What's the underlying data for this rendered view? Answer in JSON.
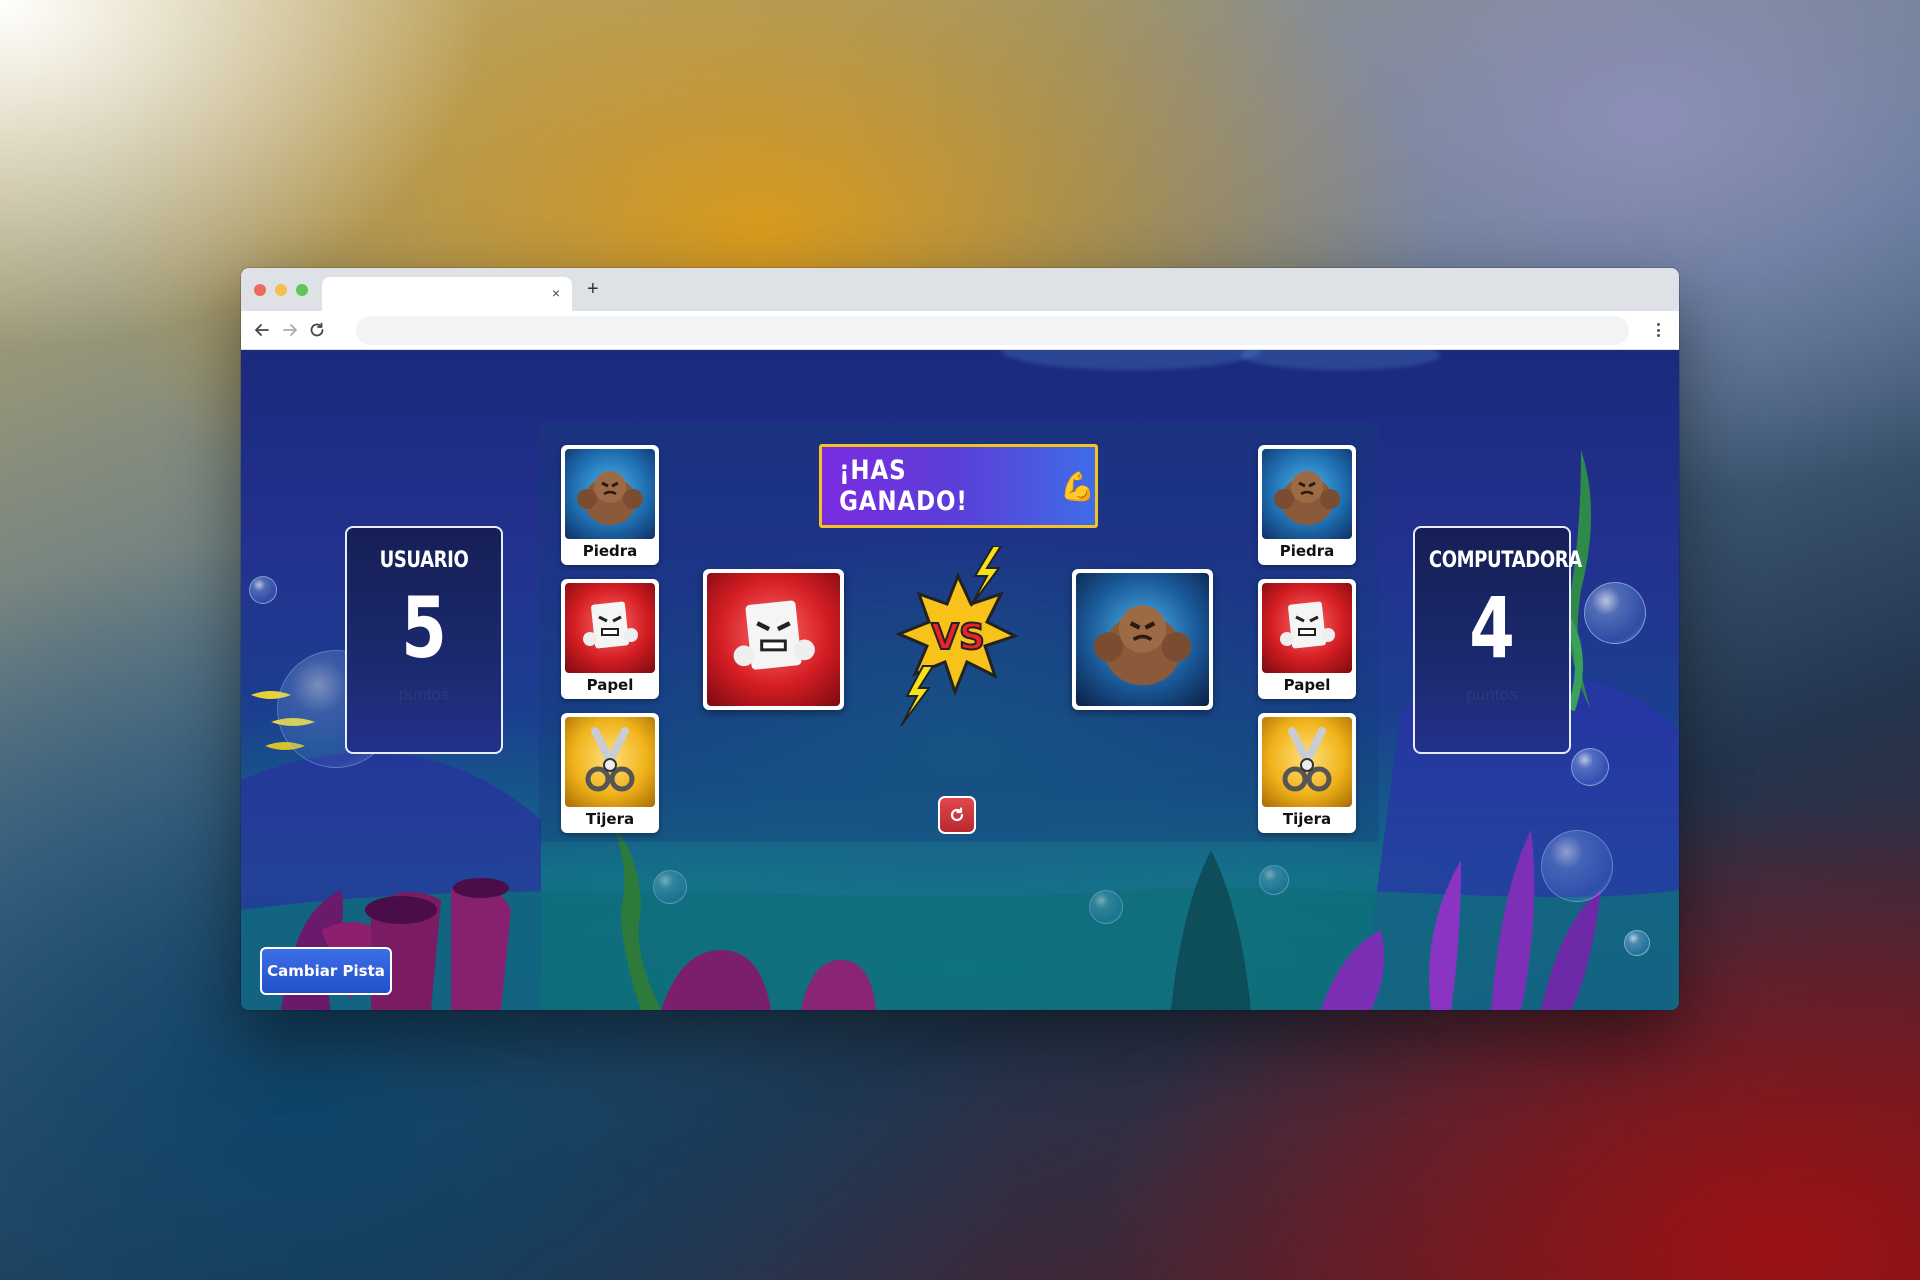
{
  "browser": {
    "tab_title": "",
    "tab_close": "×",
    "new_tab": "+",
    "address": ""
  },
  "game": {
    "user_card": {
      "title": "USUARIO",
      "score": "5",
      "unit": "puntos"
    },
    "computer_card": {
      "title": "COMPUTADORA",
      "score": "4",
      "unit": "puntos"
    },
    "result_banner": "¡HAS GANADO!",
    "result_emoji": "💪",
    "user_choices": [
      {
        "label": "Piedra",
        "icon": "rock-icon"
      },
      {
        "label": "Papel",
        "icon": "paper-icon"
      },
      {
        "label": "Tijera",
        "icon": "scissors-icon"
      }
    ],
    "computer_choices": [
      {
        "label": "Piedra",
        "icon": "rock-icon"
      },
      {
        "label": "Papel",
        "icon": "paper-icon"
      },
      {
        "label": "Tijera",
        "icon": "scissors-icon"
      }
    ],
    "user_pick": "paper-icon",
    "computer_pick": "rock-icon",
    "vs_text": "VS",
    "reset_icon": "refresh-icon",
    "change_track_label": "Cambiar Pista"
  },
  "colors": {
    "banner_border": "#f4c322",
    "banner_gradient_start": "#7a2be0",
    "banner_gradient_end": "#3f6de8",
    "reset_button": "#d03a40",
    "track_button": "#2f5fdc",
    "rock_bg": "#1f6fb2",
    "paper_bg": "#d31d23",
    "scissors_bg": "#f0b31a"
  }
}
